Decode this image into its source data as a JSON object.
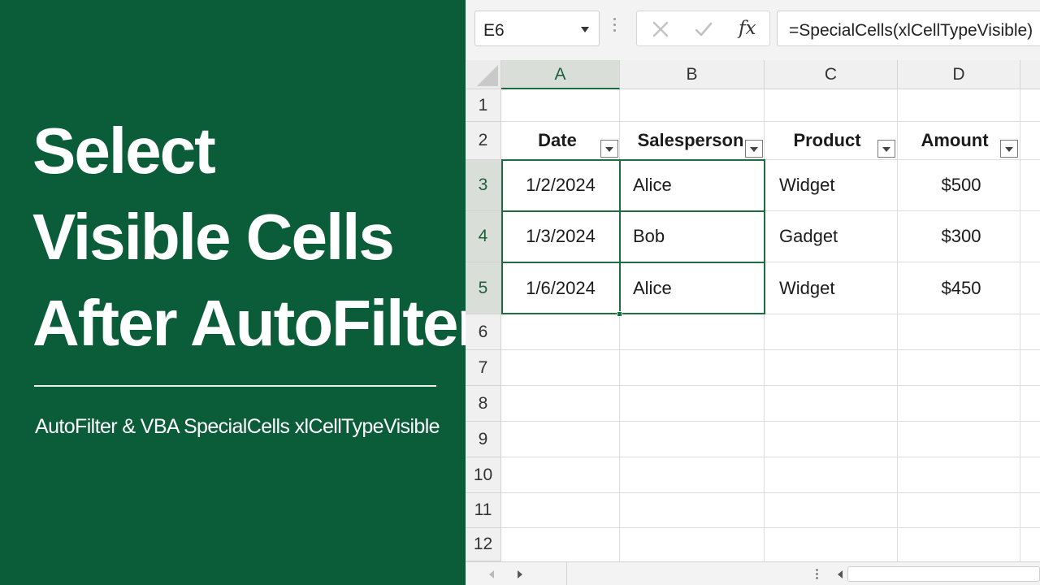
{
  "title": {
    "line1": "Select",
    "line2": "Visible Cells",
    "line3": "After AutoFilter",
    "subtitle": "AutoFilter & VBA SpecialCells xlCellTypeVisible"
  },
  "formula_bar": {
    "name_box": "E6",
    "fx_label": "fx",
    "formula": "=SpecialCells(xlCellTypeVisible)"
  },
  "columns": [
    "A",
    "B",
    "C",
    "D"
  ],
  "rows": [
    "1",
    "2",
    "3",
    "4",
    "5",
    "6",
    "7",
    "8",
    "9",
    "10",
    "11",
    "12"
  ],
  "table": {
    "headers": [
      "Date",
      "Salesperson",
      "Product",
      "Amount"
    ],
    "data": [
      [
        "1/2/2024",
        "Alice",
        "Widget",
        "$500"
      ],
      [
        "1/3/2024",
        "Bob",
        "Gadget",
        "$300"
      ],
      [
        "1/6/2024",
        "Alice",
        "Widget",
        "$450"
      ]
    ]
  },
  "colors": {
    "panel_green": "#0b5d39",
    "selection_green": "#1f6e42"
  }
}
